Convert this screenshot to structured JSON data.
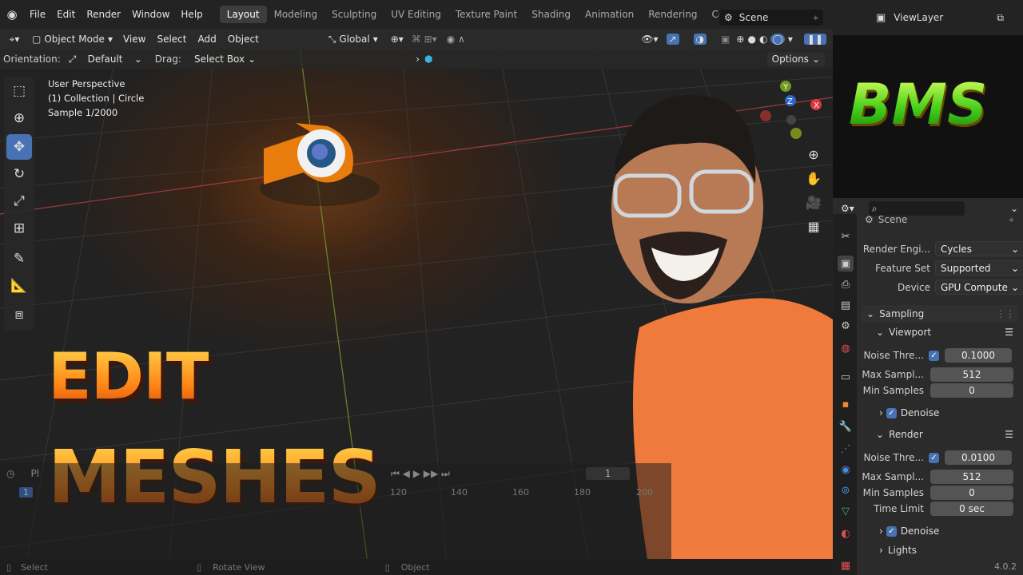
{
  "menu": {
    "items": [
      "File",
      "Edit",
      "Render",
      "Window",
      "Help"
    ]
  },
  "workspaces": {
    "active": "Layout",
    "tabs": [
      "Layout",
      "Modeling",
      "Sculpting",
      "UV Editing",
      "Texture Paint",
      "Shading",
      "Animation",
      "Rendering",
      "Compositin"
    ]
  },
  "scene": {
    "name": "Scene"
  },
  "viewlayer": {
    "name": "ViewLayer"
  },
  "header": {
    "mode": "Object Mode",
    "menus": [
      "View",
      "Select",
      "Add",
      "Object"
    ],
    "transform_orientation": "Global"
  },
  "tool_settings": {
    "orientation_label": "Orientation:",
    "orientation_value": "Default",
    "drag_label": "Drag:",
    "drag_value": "Select Box",
    "options": "Options"
  },
  "viewport_info": {
    "line1": "User Perspective",
    "line2": "(1) Collection | Circle",
    "line3": "Sample 1/2000"
  },
  "gizmo": {
    "x": "X",
    "y": "Y",
    "z": "Z"
  },
  "overlay_text": {
    "line1": "EDIT",
    "line2": "MESHES",
    "brand": "BMS"
  },
  "timeline": {
    "playback": "Pl",
    "frame": "1",
    "ticks": [
      "120",
      "140",
      "160",
      "180",
      "200"
    ]
  },
  "statusbar": {
    "select": "Select",
    "rotate": "Rotate View",
    "object": "Object"
  },
  "properties": {
    "scene_label": "Scene",
    "render_engine_label": "Render Engi...",
    "render_engine": "Cycles",
    "feature_set_label": "Feature Set",
    "feature_set": "Supported",
    "device_label": "Device",
    "device": "GPU Compute",
    "sampling": "Sampling",
    "viewport": "Viewport",
    "vp_noise_label": "Noise Thre...",
    "vp_noise": "0.1000",
    "vp_max_label": "Max Sampl...",
    "vp_max": "512",
    "vp_min_label": "Min Samples",
    "vp_min": "0",
    "denoise": "Denoise",
    "render": "Render",
    "r_noise_label": "Noise Thre...",
    "r_noise": "0.0100",
    "r_max_label": "Max Sampl...",
    "r_max": "512",
    "r_min_label": "Min Samples",
    "r_min": "0",
    "time_limit_label": "Time Limit",
    "time_limit": "0 sec",
    "denoise2": "Denoise",
    "lights": "Lights"
  },
  "version": "4.0.2"
}
